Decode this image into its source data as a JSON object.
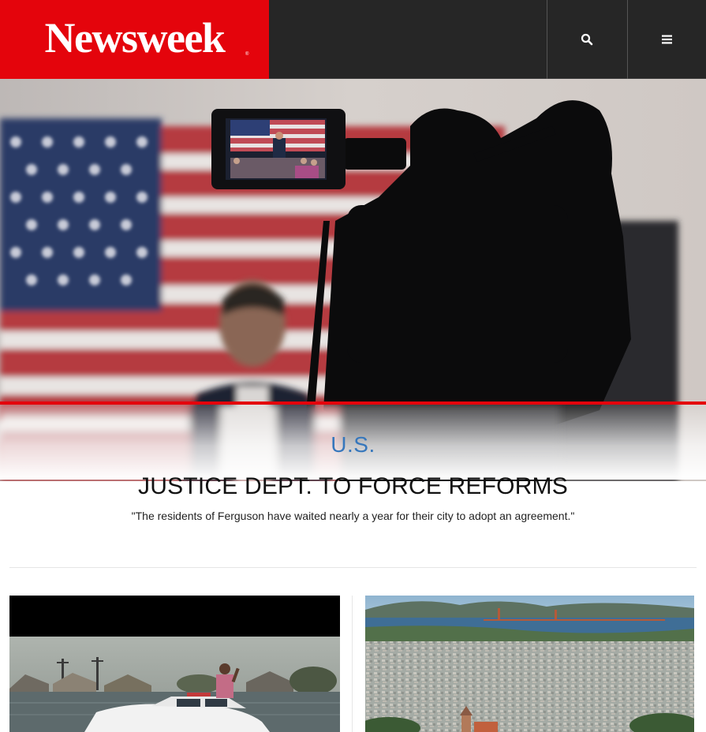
{
  "header": {
    "logo_text": "Newsweek",
    "logo_registered": "®",
    "search_icon": "search-icon",
    "menu_icon": "hamburger-menu-icon",
    "colors": {
      "brand_red": "#e4040c",
      "header_bg": "#262626"
    }
  },
  "hero": {
    "category": "U.S.",
    "headline": "JUSTICE DEPT. TO FORCE REFORMS",
    "dek": "\"The residents of Ferguson have waited nearly a year for their city to adopt an agreement.\"",
    "colors": {
      "category": "#3677bc",
      "accent_line": "#e4040c"
    }
  },
  "cards": [
    {
      "image": "flooded-street-police-car-photo"
    },
    {
      "image": "san-francisco-aerial-photo"
    }
  ]
}
